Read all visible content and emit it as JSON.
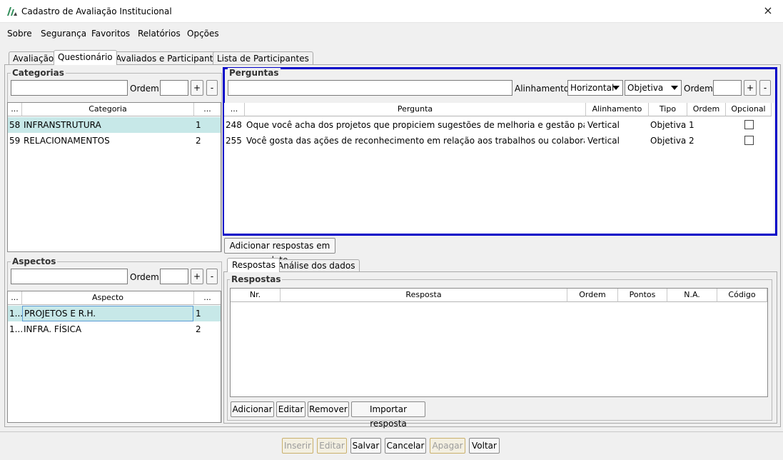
{
  "window": {
    "title": "Cadastro de Avaliação Institucional",
    "close_icon": "×"
  },
  "menu": [
    "Sobre",
    "Segurança",
    "Favoritos",
    "Relatórios",
    "Opções"
  ],
  "tabs": [
    "Avaliação",
    "Questionário",
    "Avaliados e Participantes",
    "Lista de Participantes"
  ],
  "categorias": {
    "legend": "Categorias",
    "ordem_label": "Ordem:",
    "plus": "+",
    "minus": "-",
    "columns": [
      "...",
      "Categoria",
      "..."
    ],
    "rows": [
      {
        "id": "58",
        "name": "INFRANSTRUTURA",
        "ord": "1"
      },
      {
        "id": "59",
        "name": "RELACIONAMENTOS",
        "ord": "2"
      }
    ]
  },
  "aspectos": {
    "legend": "Aspectos",
    "ordem_label": "Ordem:",
    "plus": "+",
    "minus": "-",
    "columns": [
      "...",
      "Aspecto",
      "..."
    ],
    "rows": [
      {
        "id": "1...",
        "name": "PROJETOS E R.H.",
        "ord": "1"
      },
      {
        "id": "1...",
        "name": "INFRA. FÍSICA",
        "ord": "2"
      }
    ]
  },
  "perguntas": {
    "legend": "Perguntas",
    "alinhamento_label": "Alinhamento:",
    "alinhamento_value": "Horizontal",
    "tipo_value": "Objetiva",
    "ordem_label": "Ordem:",
    "plus": "+",
    "minus": "-",
    "columns": [
      "...",
      "Pergunta",
      "Alinhamento",
      "Tipo",
      "Ordem",
      "Opcional"
    ],
    "rows": [
      {
        "id": "248",
        "text": "Oque você acha dos projetos que propiciem sugestões de melhoria e gestão para uma ...",
        "alinhamento": "Vertical",
        "tipo": "Objetiva",
        "ordem": "1"
      },
      {
        "id": "255",
        "text": "Você gosta das ações de reconhecimento em relação aos trabalhos ou colaborações vol...",
        "alinhamento": "Vertical",
        "tipo": "Objetiva",
        "ordem": "2"
      }
    ],
    "highlight_color": "#0000c8"
  },
  "lote_button": "Adicionar respostas em lote",
  "subtabs": [
    "Respostas",
    "Análise dos dados"
  ],
  "respostas": {
    "legend": "Respostas",
    "columns": [
      "Nr.",
      "Resposta",
      "Ordem",
      "Pontos",
      "N.A.",
      "Código"
    ],
    "buttons": [
      "Adicionar",
      "Editar",
      "Remover",
      "Importar resposta"
    ]
  },
  "bottom_buttons": [
    "Inserir",
    "Editar",
    "Salvar",
    "Cancelar",
    "Apagar",
    "Voltar"
  ]
}
